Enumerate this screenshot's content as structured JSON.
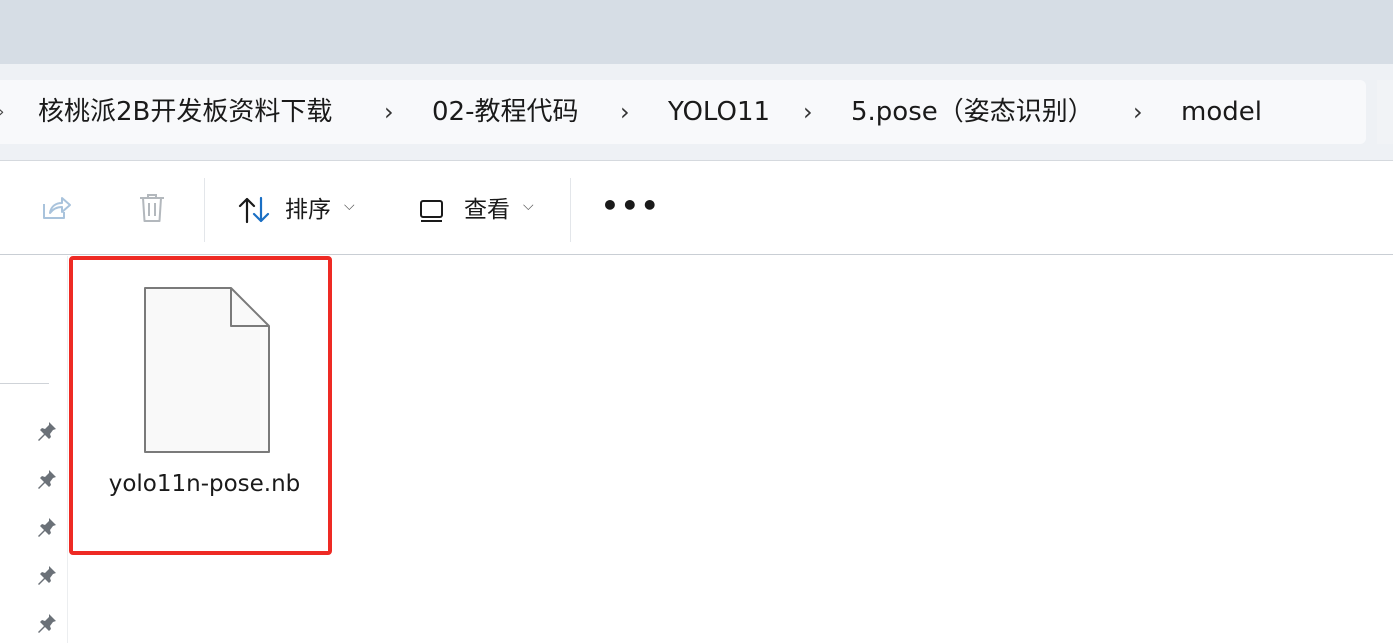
{
  "address_bar": {
    "breadcrumbs": [
      "核桃派2B开发板资料下载",
      "02-教程代码",
      "YOLO11",
      "5.pose（姿态识别）",
      "model"
    ],
    "separator": ">"
  },
  "toolbar": {
    "share_icon": "share-icon",
    "delete_icon": "trash-icon",
    "sort_label": "排序",
    "sort_icon": "sort-arrows-icon",
    "view_label": "查看",
    "view_icon": "view-rectangle-icon",
    "more_label": "•••"
  },
  "nav_pane": {
    "pinned_count": 5,
    "pin_icon": "pin-icon"
  },
  "files": [
    {
      "name": "yolo11n-pose.nb",
      "icon": "generic-file-icon",
      "selected_highlight": true
    }
  ],
  "colors": {
    "highlight_box": "#ee2a24",
    "title_bar": "#d6dde5",
    "address_area": "#eef1f5"
  }
}
